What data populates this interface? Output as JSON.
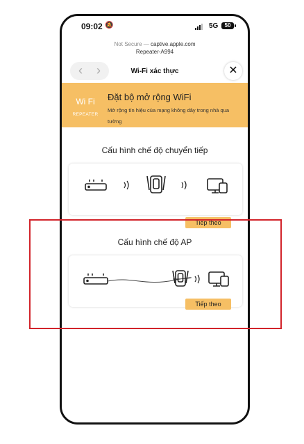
{
  "status_bar": {
    "time": "09:02",
    "network": "5G",
    "battery": "50"
  },
  "browser": {
    "security": "Not Secure —",
    "host": "captive.apple.com",
    "network_name": "Repeater-A994",
    "title": "Wi-Fi xác thực",
    "back_icon": "chevron-left-icon",
    "forward_icon": "chevron-right-icon",
    "close_icon": "close-icon"
  },
  "banner": {
    "logo_wifi": "Wi Fi",
    "logo_sub": "REPEATER",
    "title": "Đặt bộ mở rộng WiFi",
    "description": "Mở rộng tín hiệu của mạng không dây trong nhà qua tường",
    "color": "#f6bf64"
  },
  "sections": [
    {
      "title": "Cấu hình chế độ chuyển tiếp",
      "button": "Tiếp theo"
    },
    {
      "title": "Cấu hình chế độ AP",
      "button": "Tiếp theo"
    }
  ],
  "highlight_color": "#d2232a"
}
